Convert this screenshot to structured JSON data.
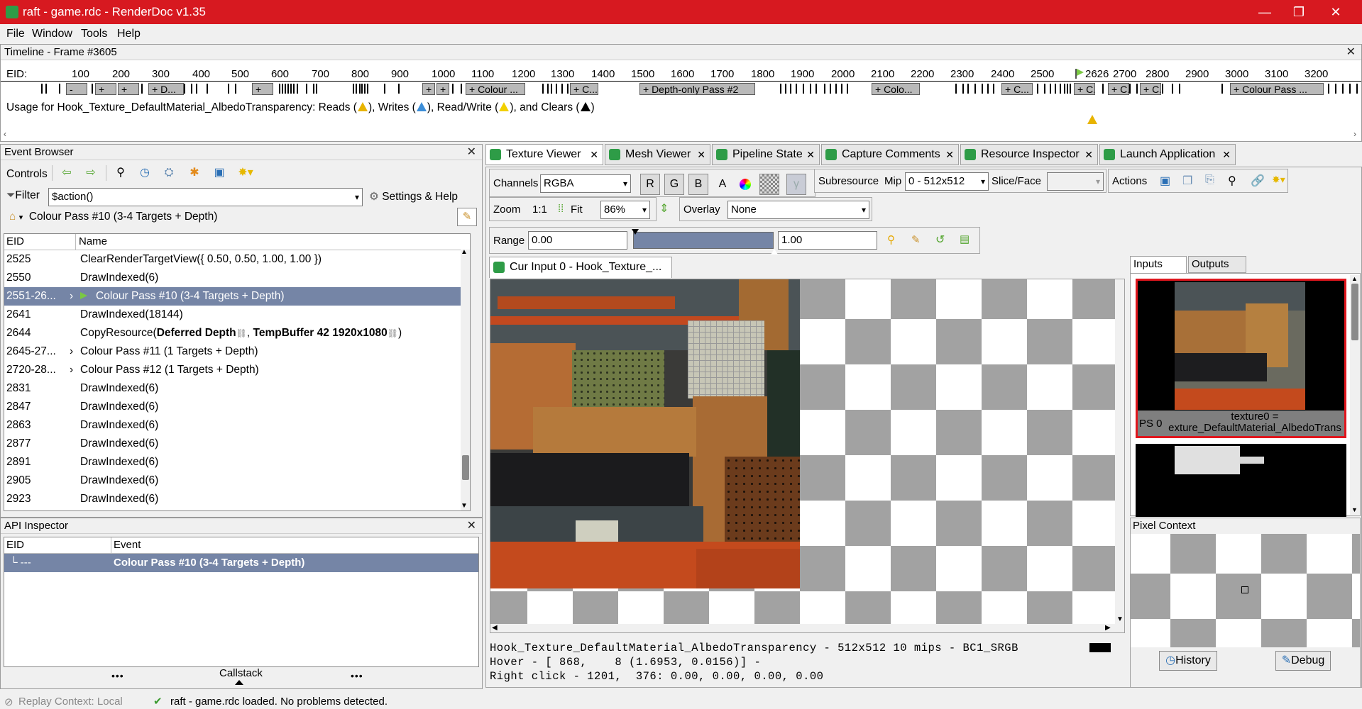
{
  "window": {
    "title": "raft - game.rdc - RenderDoc v1.35",
    "minimize": "—",
    "maximize": "❐",
    "close": "✕"
  },
  "menu": [
    "File",
    "Window",
    "Tools",
    "Help"
  ],
  "timeline": {
    "title": "Timeline - Frame #3605",
    "eid_label": "EID:",
    "ruler": [
      "100",
      "200",
      "300",
      "400",
      "500",
      "600",
      "700",
      "800",
      "900",
      "1000",
      "1100",
      "1200",
      "1300",
      "1400",
      "1500",
      "1600",
      "1700",
      "1800",
      "1900",
      "2000",
      "2100",
      "2200",
      "2300",
      "2400",
      "2500",
      "2626",
      "2700",
      "2800",
      "2900",
      "3000",
      "3100",
      "3200"
    ],
    "sections": [
      "-",
      "+",
      "+",
      "+ D...",
      "+",
      "+",
      "+",
      "+ Colour ...",
      "+ C...",
      "+ Depth-only Pass #2",
      "+ Colo...",
      "+ C...",
      "+ C...",
      "+ C...",
      "+ C...",
      "+ Colour Pass ..."
    ],
    "usage_prefix": "Usage for Hook_Texture_DefaultMaterial_AlbedoTransparency: Reads (",
    "usage_writes": "), Writes (",
    "usage_rw": "), Read/Write (",
    "usage_clears": "), and Clears (",
    "usage_end": ")",
    "colors": {
      "read": "#e8b400",
      "write": "#3d8ed8",
      "readwrite": "#f2d000",
      "clear": "#000000"
    }
  },
  "event_browser": {
    "title": "Event Browser",
    "controls_label": "Controls",
    "filter_label": "Filter",
    "filter_value": "$action()",
    "settings_label": "Settings & Help",
    "breadcrumb": "Colour Pass #10 (3-4 Targets + Depth)",
    "columns": [
      "EID",
      "Name"
    ],
    "rows": [
      {
        "eid": "2525",
        "name": "ClearRenderTargetView({ 0.50, 0.50, 1.00, 1.00 })",
        "expand": "",
        "selected": false
      },
      {
        "eid": "2550",
        "name": "DrawIndexed(6)",
        "expand": "",
        "selected": false
      },
      {
        "eid": "2551-26...",
        "name": "Colour Pass #10 (3-4 Targets + Depth)",
        "expand": "›",
        "selected": true
      },
      {
        "eid": "2641",
        "name": "DrawIndexed(18144)",
        "expand": "",
        "selected": false
      },
      {
        "eid": "2644",
        "name": "",
        "expand": "",
        "selected": false
      },
      {
        "eid": "2645-27...",
        "name": "Colour Pass #11 (1 Targets + Depth)",
        "expand": "›",
        "selected": false
      },
      {
        "eid": "2720-28...",
        "name": "Colour Pass #12 (1 Targets + Depth)",
        "expand": "›",
        "selected": false
      },
      {
        "eid": "2831",
        "name": "DrawIndexed(6)",
        "expand": "",
        "selected": false
      },
      {
        "eid": "2847",
        "name": "DrawIndexed(6)",
        "expand": "",
        "selected": false
      },
      {
        "eid": "2863",
        "name": "DrawIndexed(6)",
        "expand": "",
        "selected": false
      },
      {
        "eid": "2877",
        "name": "DrawIndexed(6)",
        "expand": "",
        "selected": false
      },
      {
        "eid": "2891",
        "name": "DrawIndexed(6)",
        "expand": "",
        "selected": false
      },
      {
        "eid": "2905",
        "name": "DrawIndexed(6)",
        "expand": "",
        "selected": false
      },
      {
        "eid": "2923",
        "name": "DrawIndexed(6)",
        "expand": "",
        "selected": false
      }
    ],
    "copy_resource": {
      "prefix": "CopyResource(",
      "src": "Deferred Depth",
      "sep": ", ",
      "dst": "TempBuffer 42 1920x1080",
      "suffix": ")"
    }
  },
  "api_inspector": {
    "title": "API Inspector",
    "columns": [
      "EID",
      "Event"
    ],
    "row": {
      "eid": "└ ---",
      "event": "Colour Pass #10 (3-4 Targets + Depth)"
    },
    "callstack_label": "Callstack",
    "dots": "•••"
  },
  "tabs": [
    "Texture Viewer",
    "Mesh Viewer",
    "Pipeline State",
    "Capture Comments",
    "Resource Inspector",
    "Launch Application"
  ],
  "texture_viewer": {
    "channels_label": "Channels",
    "channels_value": "RGBA",
    "channel_buttons": [
      "R",
      "G",
      "B",
      "A"
    ],
    "gamma_label": "γ",
    "subresource_label": "Subresource",
    "mip_label": "Mip",
    "mip_value": "0 - 512x512",
    "slice_label": "Slice/Face",
    "actions_label": "Actions",
    "zoom_label": "Zoom",
    "zoom_1to1": "1:1",
    "fit_label": "Fit",
    "zoom_value": "86%",
    "overlay_label": "Overlay",
    "overlay_value": "None",
    "range_label": "Range",
    "range_min": "0.00",
    "range_max": "1.00",
    "image_tab": "Cur Input 0 - Hook_Texture_...",
    "status_line1": "Hook_Texture_DefaultMaterial_AlbedoTransparency - 512x512 10 mips - BC1_SRGB",
    "status_line2": "Hover - [ 868,    8 (1.6953, 0.0156)] -",
    "status_line3": "Right click - 1201,  376: 0.00, 0.00, 0.00, 0.00"
  },
  "inputs_panel": {
    "tab_inputs": "Inputs",
    "tab_outputs": "Outputs",
    "thumb_label_line1": "texture0 =",
    "thumb_label_prefix": "PS 0",
    "thumb_label_line2": "exture_DefaultMaterial_AlbedoTrans",
    "pixel_context_title": "Pixel Context",
    "history_label": "History",
    "debug_label": "Debug"
  },
  "status_bar": {
    "replay_context": "Replay Context: Local",
    "message": "raft - game.rdc loaded. No problems detected."
  }
}
